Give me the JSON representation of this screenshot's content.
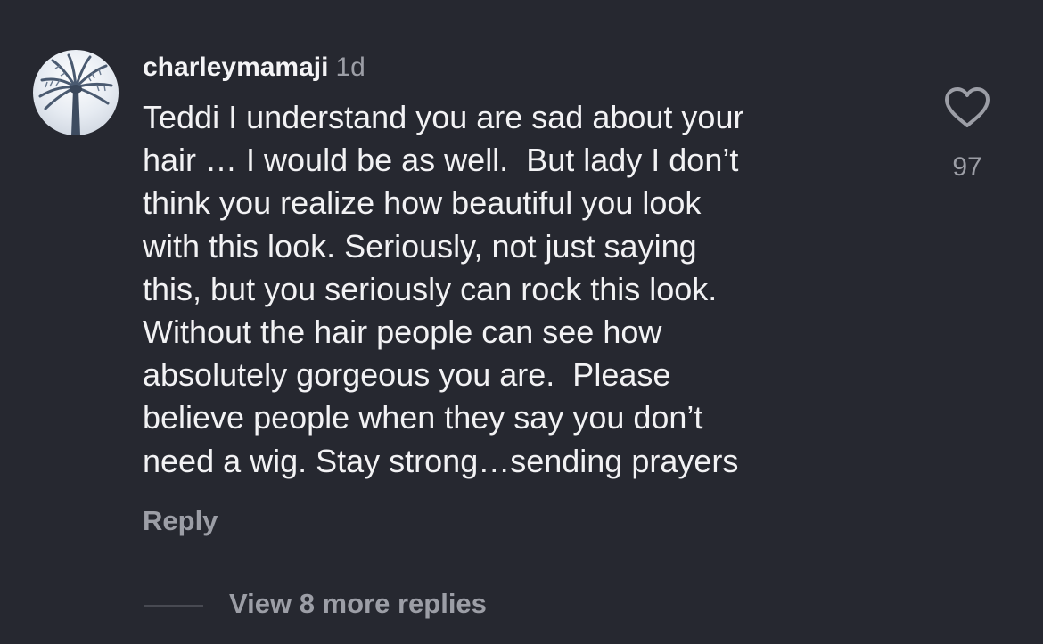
{
  "comment": {
    "username": "charleymamaji",
    "timestamp": "1d",
    "avatar_icon": "palm-tree-avatar",
    "lines": [
      "Teddi I understand you are sad about your",
      "hair … I would be as well.  But lady I don’t",
      "think you realize how beautiful you look",
      "with this look. Seriously, not just saying",
      "this, but you seriously can rock this look.",
      "Without the hair people can see how",
      "absolutely gorgeous you are.  Please",
      "believe people when they say you don’t",
      "need a wig. Stay strong…sending prayers"
    ],
    "reply_label": "Reply",
    "like_icon": "heart-outline-icon",
    "like_count": "97",
    "view_replies_label": "View 8 more replies"
  },
  "colors": {
    "background": "#262830",
    "primary_text": "#f2f2f4",
    "secondary_text": "#9c9ea6"
  }
}
